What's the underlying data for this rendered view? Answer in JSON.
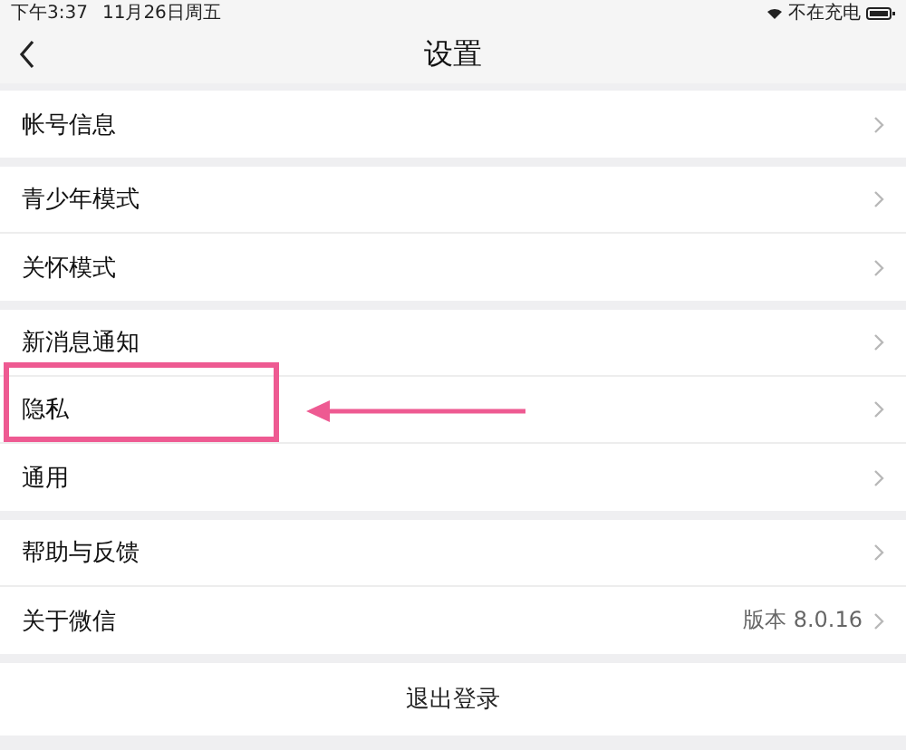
{
  "status_bar": {
    "time": "下午3:37",
    "date": "11月26日周五",
    "charging": "不在充电"
  },
  "nav": {
    "title": "设置"
  },
  "sections": [
    {
      "rows": [
        {
          "label": "帐号信息",
          "highlighted": false
        }
      ]
    },
    {
      "rows": [
        {
          "label": "青少年模式",
          "highlighted": false
        },
        {
          "label": "关怀模式",
          "highlighted": false
        }
      ]
    },
    {
      "rows": [
        {
          "label": "新消息通知",
          "highlighted": false
        },
        {
          "label": "隐私",
          "highlighted": true
        },
        {
          "label": "通用",
          "highlighted": false
        }
      ]
    },
    {
      "rows": [
        {
          "label": "帮助与反馈",
          "highlighted": false
        },
        {
          "label": "关于微信",
          "value": "版本 8.0.16",
          "highlighted": false
        }
      ]
    }
  ],
  "logout": "退出登录"
}
